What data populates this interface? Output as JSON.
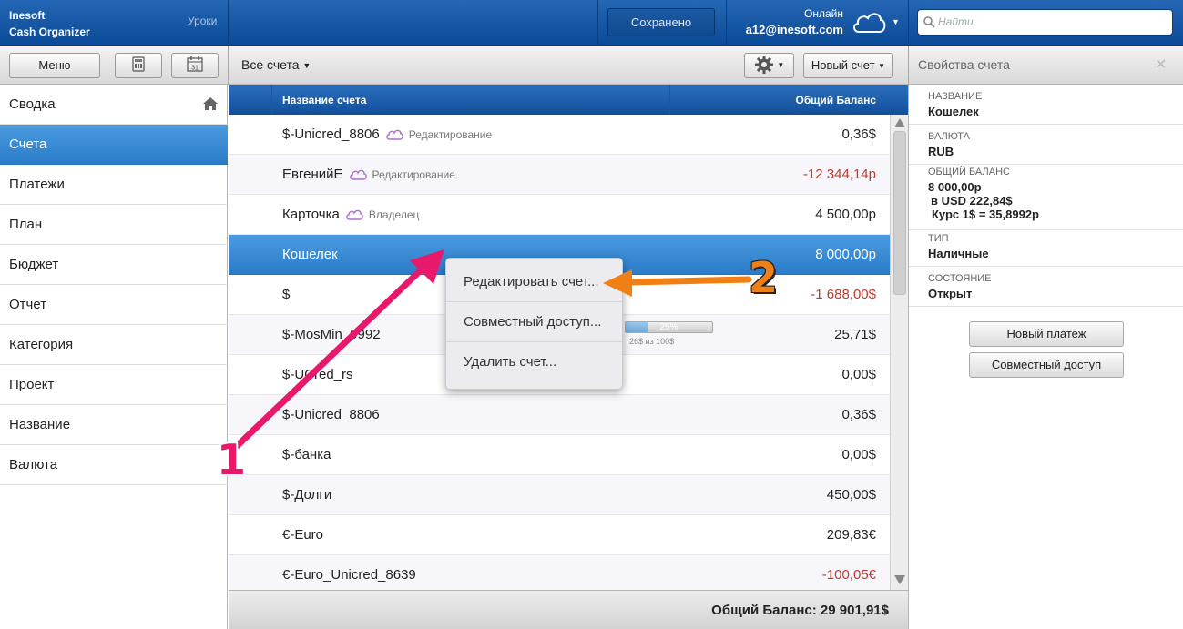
{
  "header": {
    "brand_line1": "Inesoft",
    "brand_line2": "Cash Organizer",
    "lessons": "Уроки",
    "saved": "Сохранено",
    "online": "Онлайн",
    "email": "a12@inesoft.com",
    "cloud_icon": "cloud-icon",
    "search_placeholder": "Найти"
  },
  "toolbar": {
    "menu": "Меню",
    "calculator_icon": "calculator-icon",
    "calendar_icon": "calendar-icon",
    "calendar_day": "31",
    "accounts_filter": "Все счета",
    "gear_icon": "gear-icon",
    "new_account": "Новый счет",
    "props_title": "Свойства счета",
    "close": "✕"
  },
  "sidebar": {
    "items": [
      {
        "label": "Сводка",
        "icon": "home-icon"
      },
      {
        "label": "Счета",
        "active": true
      },
      {
        "label": "Платежи"
      },
      {
        "label": "План"
      },
      {
        "label": "Бюджет"
      },
      {
        "label": "Отчет"
      },
      {
        "label": "Категория"
      },
      {
        "label": "Проект"
      },
      {
        "label": "Название"
      },
      {
        "label": "Валюта"
      }
    ]
  },
  "table": {
    "col_name": "Название счета",
    "col_balance": "Общий Баланс",
    "rows": [
      {
        "name": "$-Unicred_8806",
        "status": "Редактирование",
        "cloud": true,
        "balance": "0,36$"
      },
      {
        "name": "ЕвгенийЕ",
        "status": "Редактирование",
        "cloud": true,
        "balance": "-12 344,14р",
        "negative": true
      },
      {
        "name": "Карточка",
        "status": "Владелец",
        "cloud": true,
        "balance": "4 500,00р"
      },
      {
        "name": "Кошелек",
        "balance": "8 000,00р",
        "selected": true
      },
      {
        "name": "$",
        "balance": "-1 688,00$",
        "negative": true
      },
      {
        "name": "$-MosMin_0992",
        "balance": "25,71$",
        "progress": {
          "percent": 25,
          "label": "25%",
          "sub": "26$ из 100$"
        }
      },
      {
        "name": "$-UCred_rs",
        "balance": "0,00$"
      },
      {
        "name": "$-Unicred_8806",
        "balance": "0,36$"
      },
      {
        "name": "$-банка",
        "balance": "0,00$"
      },
      {
        "name": "$-Долги",
        "balance": "450,00$"
      },
      {
        "name": "€-Euro",
        "balance": "209,83€"
      },
      {
        "name": "€-Euro_Unicred_8639",
        "balance": "-100,05€",
        "negative": true
      }
    ],
    "total": "Общий Баланс: 29 901,91$"
  },
  "context_menu": {
    "items": [
      "Редактировать счет...",
      "Совместный доступ...",
      "Удалить счет..."
    ]
  },
  "properties": {
    "name_label": "НАЗВАНИЕ",
    "name_value": "Кошелек",
    "currency_label": "ВАЛЮТА",
    "currency_value": "RUB",
    "balance_label": "ОБЩИЙ БАЛАНС",
    "balance_value": "8 000,00р",
    "balance_usd": "в USD 222,84$",
    "balance_rate": "Курс 1$ = 35,8992р",
    "type_label": "ТИП",
    "type_value": "Наличные",
    "state_label": "СОСТОЯНИЕ",
    "state_value": "Открыт",
    "new_payment": "Новый платеж",
    "shared_access": "Совместный доступ"
  },
  "annotations": {
    "marker1": "1",
    "marker2": "2",
    "marker1_color": "#e8186a",
    "marker2_color": "#f07f15"
  }
}
